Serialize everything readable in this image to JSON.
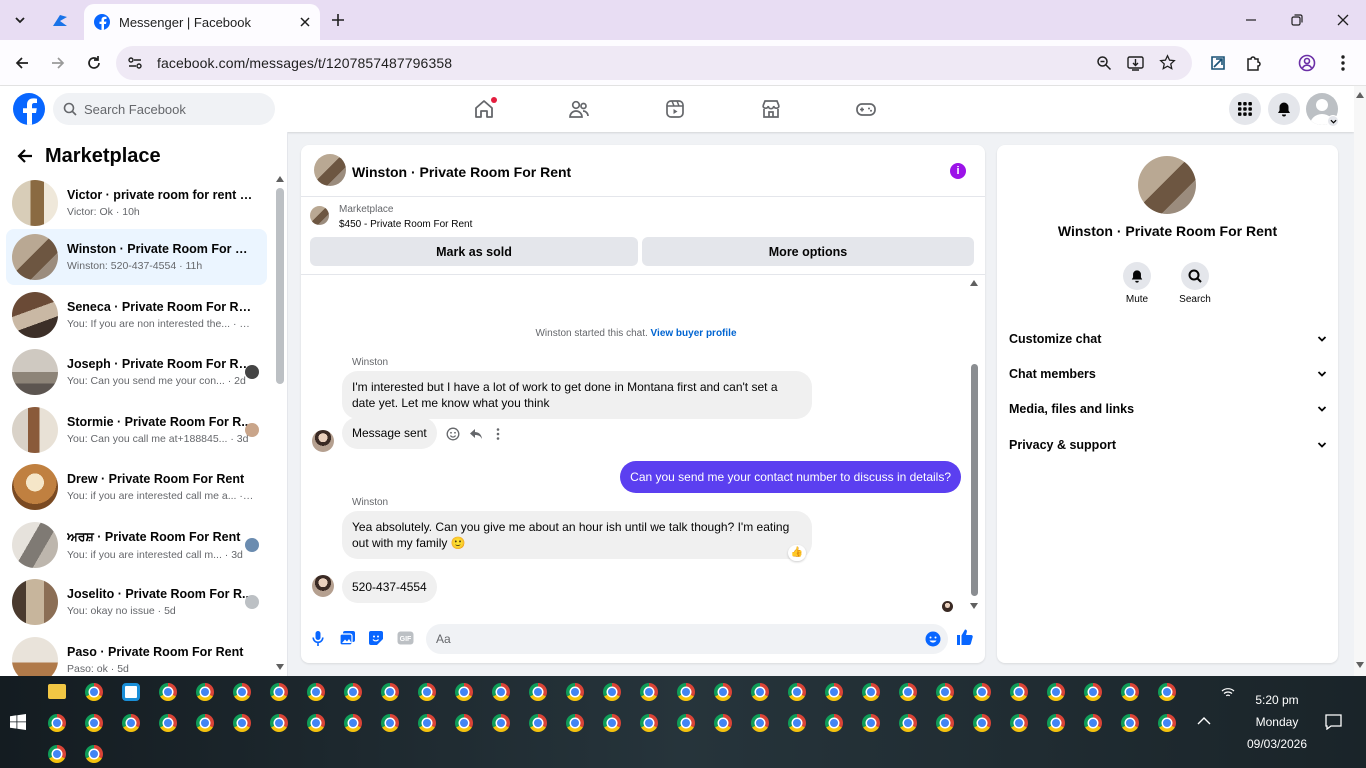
{
  "browser": {
    "tab_title": "Messenger | Facebook",
    "url": "facebook.com/messages/t/1207857487796358"
  },
  "fb": {
    "search_placeholder": "Search Facebook"
  },
  "sidebar": {
    "title": "Marketplace",
    "conversations": [
      {
        "name": "Victor · private room for rent ne...",
        "preview": "Victor: Ok · 10h"
      },
      {
        "name": "Winston · Private Room For Rent",
        "preview": "Winston: 520-437-4554 · 11h"
      },
      {
        "name": "Seneca · Private Room For Rent",
        "preview": "You: If you are non interested the... · 21h"
      },
      {
        "name": "Joseph · Private Room For Rent",
        "preview": "You: Can you send me your con... · 2d"
      },
      {
        "name": "Stormie · Private Room For R...",
        "preview": "You: Can you call me at+188845... · 3d"
      },
      {
        "name": "Drew · Private Room For Rent",
        "preview": "You: if you are interested call me a... · 3d"
      },
      {
        "name": "ਅਰਸ਼ · Private Room For Rent",
        "preview": "You: if you are interested call m... · 3d"
      },
      {
        "name": "Joselito · Private Room For R...",
        "preview": "You: okay no issue · 5d"
      },
      {
        "name": "Paso · Private Room For Rent",
        "preview": "Paso: ok · 5d"
      }
    ]
  },
  "chat": {
    "title": "Winston · Private Room For Rent",
    "marketplace_label": "Marketplace",
    "listing": "$450 - Private Room For Rent",
    "mark_sold": "Mark as sold",
    "more_options": "More options",
    "started_text": "Winston started this chat.",
    "view_profile": "View buyer profile",
    "sender": "Winston",
    "msg1": "I'm interested but I have a lot of work to get done in Montana first and can't set a date yet. Let me know what you think",
    "msg2": "Message sent",
    "msg3": "Can you send me your contact number to discuss in details?",
    "msg4": "Yea absolutely. Can you give me about an hour ish until we talk though? I'm eating out with my family 🙂",
    "msg4_reaction": "👍",
    "msg5": "520-437-4554",
    "composer_placeholder": "Aa"
  },
  "info": {
    "title": "Winston · Private Room For Rent",
    "mute": "Mute",
    "search": "Search",
    "sections": [
      "Customize chat",
      "Chat members",
      "Media, files and links",
      "Privacy & support"
    ]
  },
  "taskbar": {
    "time": "5:20 pm",
    "day": "Monday",
    "date": "09/03/2026"
  },
  "colors": {
    "fb_blue": "#0866ff",
    "outgoing_bubble": "#5b3ff0",
    "active_row": "#ebf5ff",
    "info_icon": "#9b13e8"
  }
}
